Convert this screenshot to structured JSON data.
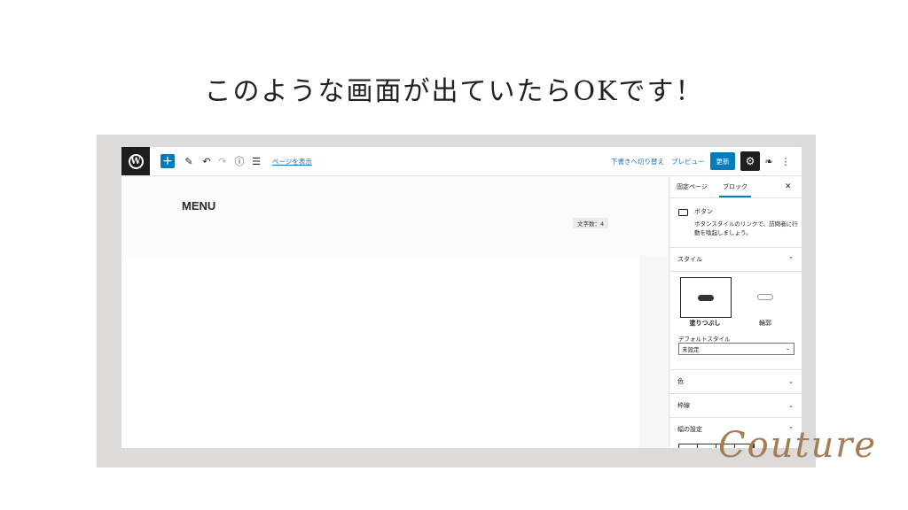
{
  "headline": "このような画面が出ていたらOKです！",
  "toolbar": {
    "add": "+",
    "view_page": "ページを表示",
    "switch_to_draft": "下書きへ切り替え",
    "preview": "プレビュー",
    "update": "更新"
  },
  "canvas": {
    "heading": "MENU",
    "word_count": "文字数：4"
  },
  "sidebar": {
    "tab_page": "固定ページ",
    "tab_block": "ブロック",
    "block_title": "ボタン",
    "block_description": "ボタンスタイルのリンクで、訪問者に行動を喚起しましょう。",
    "style_label": "スタイル",
    "style_fill": "塗りつぶし",
    "style_outline": "輪郭",
    "default_style_label": "デフォルトスタイル",
    "default_style_value": "未設定",
    "color_label": "色",
    "border_label": "枠線",
    "width_label": "幅の設定"
  },
  "brand": "Couture",
  "icons": [
    "wordpress-logo-icon",
    "plus-icon",
    "pencil-icon",
    "undo-icon",
    "redo-icon",
    "info-icon",
    "list-view-icon",
    "gear-icon",
    "leaf-icon",
    "more-vertical-icon",
    "close-icon",
    "button-block-icon",
    "chevron-up-icon",
    "chevron-down-icon"
  ]
}
